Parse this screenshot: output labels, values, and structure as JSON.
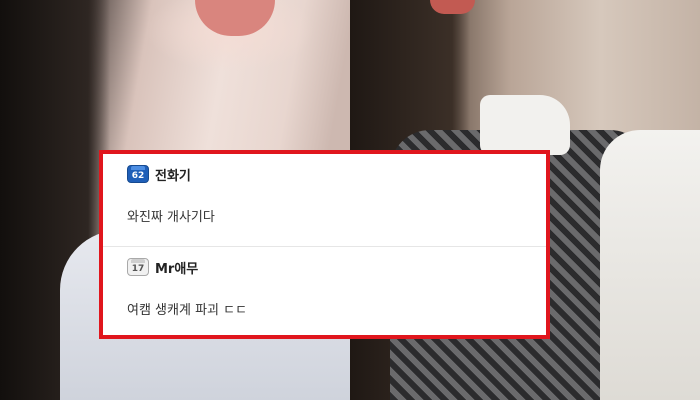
{
  "comments": [
    {
      "level": "62",
      "username": "전화기",
      "text": "와진짜 개사기다"
    },
    {
      "level": "17",
      "username": "Mr애무",
      "text": "여캠 생캐계 파괴 ㄷㄷ"
    }
  ],
  "colors": {
    "highlight_border": "#e0161d",
    "badge_high": "#1f5fb8",
    "badge_low": "#f1f1f1"
  }
}
